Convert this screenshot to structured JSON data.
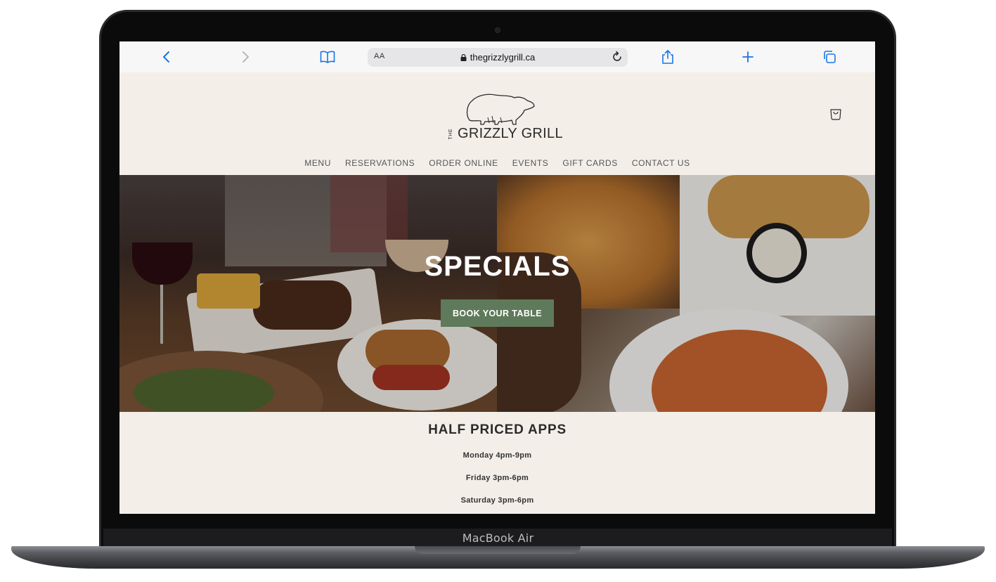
{
  "device": {
    "model_label": "MacBook Air"
  },
  "browser": {
    "text_size_label": "AA",
    "url": "thegrizzlygrill.ca",
    "icons": [
      "back-icon",
      "forward-icon",
      "bookmarks-icon",
      "lock-icon",
      "reload-icon",
      "share-icon",
      "new-tab-icon",
      "tabs-icon"
    ]
  },
  "site": {
    "logo": {
      "prefix": "THE",
      "name": "GRIZZLY GRILL"
    },
    "nav": [
      "MENU",
      "RESERVATIONS",
      "ORDER ONLINE",
      "EVENTS",
      "GIFT CARDS",
      "CONTACT US"
    ],
    "hero": {
      "title": "SPECIALS",
      "button": "BOOK YOUR TABLE"
    },
    "specials": {
      "heading": "HALF PRICED APPS",
      "hours": [
        "Monday 4pm-9pm",
        "Friday 3pm-6pm",
        "Saturday 3pm-6pm"
      ]
    }
  },
  "colors": {
    "page_bg": "#f3efe8",
    "button_green": "#5f7a5a",
    "link_blue": "#1a73e8"
  }
}
